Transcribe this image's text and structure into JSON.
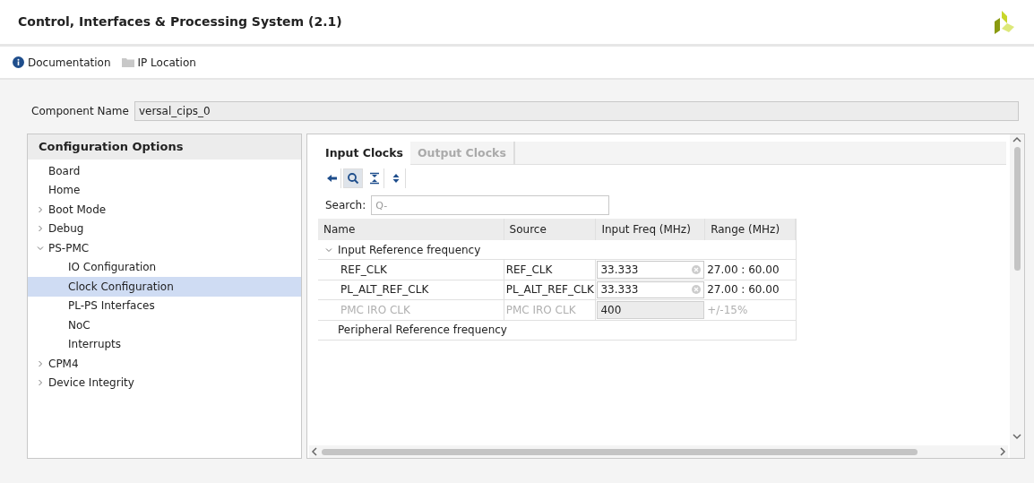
{
  "window": {
    "title": "Control, Interfaces & Processing System (2.1)"
  },
  "links": [
    {
      "kind": "info",
      "label": "Documentation"
    },
    {
      "kind": "folder",
      "label": "IP Location"
    }
  ],
  "component": {
    "label": "Component Name",
    "value": "versal_cips_0"
  },
  "sidebar": {
    "title": "Configuration Options",
    "items": [
      {
        "label": "Board",
        "selected": false
      },
      {
        "label": "Home",
        "selected": false
      },
      {
        "label": "Boot Mode",
        "selected": false,
        "expanded": false
      },
      {
        "label": "Debug",
        "selected": false,
        "expanded": false
      },
      {
        "label": "PS-PMC",
        "selected": false,
        "expanded": true,
        "children": [
          {
            "label": "IO Configuration",
            "selected": false
          },
          {
            "label": "Clock Configuration",
            "selected": true
          },
          {
            "label": "PL-PS Interfaces",
            "selected": false
          },
          {
            "label": "NoC",
            "selected": false
          },
          {
            "label": "Interrupts",
            "selected": false
          }
        ]
      },
      {
        "label": "CPM4",
        "selected": false,
        "expanded": false
      },
      {
        "label": "Device Integrity",
        "selected": false,
        "expanded": false
      }
    ]
  },
  "tabs": [
    {
      "label": "Input Clocks",
      "selected": true
    },
    {
      "label": "Output Clocks",
      "selected": false
    }
  ],
  "toolbar": [
    {
      "kind": "back",
      "selected": false
    },
    {
      "kind": "search",
      "selected": true
    },
    {
      "kind": "collapse",
      "selected": false
    },
    {
      "kind": "expand",
      "selected": false
    }
  ],
  "search": {
    "label": "Search:",
    "placeholder": "Q-"
  },
  "table": {
    "columns": [
      "Name",
      "Source",
      "Input Freq (MHz)",
      "Range (MHz)"
    ],
    "groups": [
      {
        "label": "Input Reference frequency",
        "expanded": true,
        "rows": [
          {
            "name": "REF_CLK",
            "source": "REF_CLK",
            "freq": "33.333",
            "range": "27.00 : 60.00",
            "disabled": false
          },
          {
            "name": "PL_ALT_REF_CLK",
            "source": "PL_ALT_REF_CLK",
            "freq": "33.333",
            "range": "27.00 : 60.00",
            "disabled": false
          },
          {
            "name": "PMC IRO CLK",
            "source": "PMC IRO CLK",
            "freq": "400",
            "range": "+/-15%",
            "disabled": true
          }
        ]
      },
      {
        "label": "Peripheral Reference frequency",
        "expanded": false
      }
    ]
  }
}
